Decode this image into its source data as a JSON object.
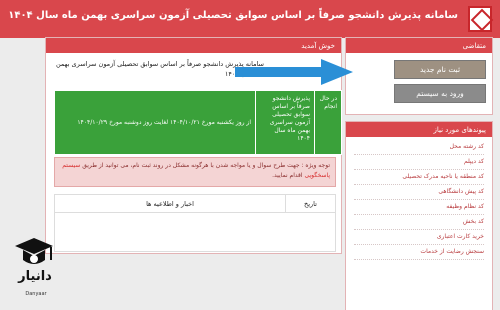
{
  "header": {
    "title": "سامانه پذیرش دانشجو صرفاً بر اساس سوابق تحصیلی آزمون سراسری بهمن ماه سال ۱۴۰۴"
  },
  "sidebar": {
    "applicants_title": "متقاضی",
    "register_label": "ثبت نام جدید",
    "login_label": "ورود به سیستم",
    "links_title": "پیوندهای مورد نیاز",
    "links": [
      "کد رشته محل",
      "کد دیپلم",
      "کد منطقه یا ناحیه مدرک تحصیلی",
      "کد پیش دانشگاهی",
      "کد نظام وظیفه",
      "کد بخش",
      "خرید کارت اعتباری",
      "سنجش رضایت از خدمات"
    ]
  },
  "main": {
    "title": "خوش آمدید",
    "intro": "سامانه پذیرش دانشجو صرفاً بر اساس سوابق تحصیلی آزمون سراسری بهمن ماه سال ۱۴۰۴",
    "notice_status": "در حال انجام",
    "notice_desc": "پذیرش دانشجو صرفاً بر اساس سوابق تحصیلی آزمون سراسری بهمن ماه سال ۱۴۰۴",
    "notice_period": "از روز یکشنبه مورخ ۱۴۰۴/۱۰/۲۱ لغایت روز دوشنبه مورخ ۱۴۰۴/۱۰/۲۹",
    "warning_prefix": "توجه ویژه : جهت طرح سوال و یا مواجه شدن با هرگونه مشکل در روند ثبت نام، می توانید از طریق",
    "warning_link": "سیستم پاسخگویی",
    "warning_suffix": "اقدام نمایید.",
    "news_col_date": "تاریخ",
    "news_col_news": "اخبار و اطلاعیه ها"
  },
  "watermark": {
    "text": "دانیار",
    "sub": "Danyaar"
  },
  "colors": {
    "brand": "#d9474c",
    "green": "#3aa13a",
    "arrow": "#2a8fd6"
  }
}
